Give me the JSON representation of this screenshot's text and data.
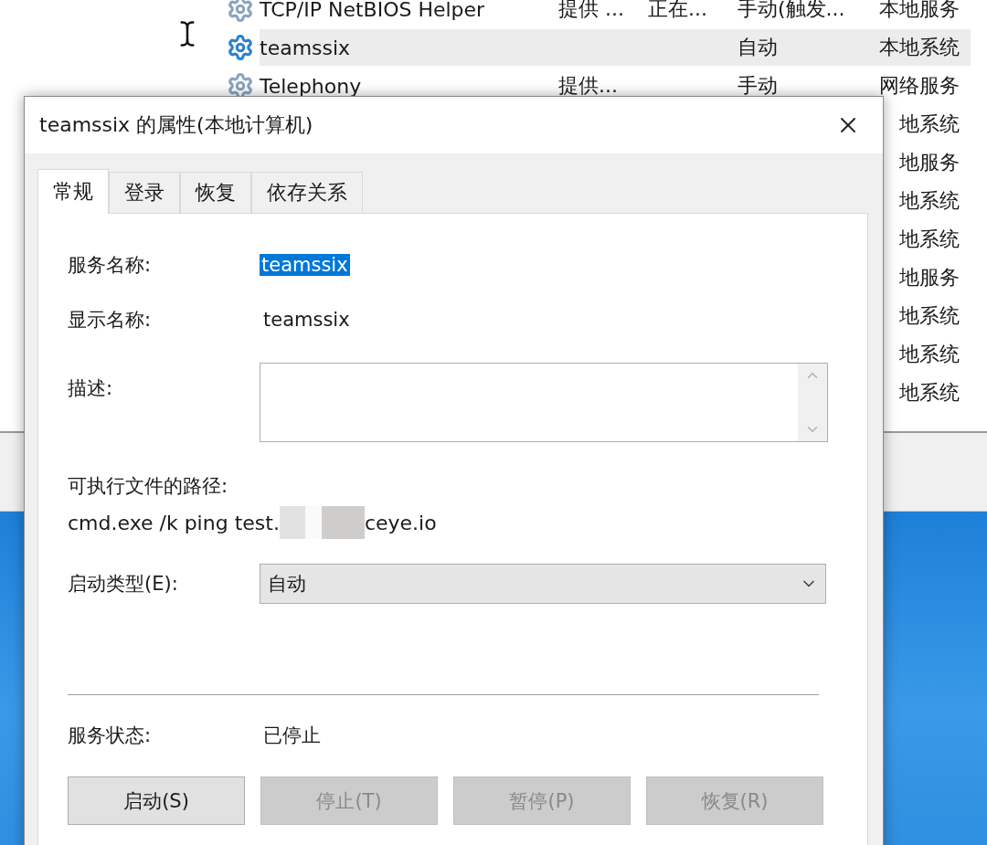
{
  "services": {
    "rows": [
      {
        "name": "TCP/IP NetBIOS Helper",
        "description": "提供 ...",
        "status": "正在...",
        "startup": "手动(触发...",
        "logon": "本地服务",
        "selected": false
      },
      {
        "name": "teamssix",
        "startup": "自动",
        "logon": "本地系统",
        "selected": true
      },
      {
        "name": "Telephony",
        "description": "提供...",
        "startup": "手动",
        "logon": "网络服务",
        "selected": false
      },
      {
        "logon": "地系统",
        "selected": false
      },
      {
        "logon": "地服务",
        "selected": false
      },
      {
        "logon": "地系统",
        "selected": false
      },
      {
        "logon": "地系统",
        "selected": false
      },
      {
        "logon": "地服务",
        "selected": false
      },
      {
        "logon": "地系统",
        "selected": false
      },
      {
        "logon": "地系统",
        "selected": false
      },
      {
        "logon": "地系统",
        "selected": false
      }
    ]
  },
  "dialog": {
    "title": "teamssix 的属性(本地计算机)",
    "tabs": [
      {
        "label": "常规",
        "selected": true
      },
      {
        "label": "登录",
        "selected": false
      },
      {
        "label": "恢复",
        "selected": false
      },
      {
        "label": "依存关系",
        "selected": false
      }
    ],
    "service_name": {
      "label": "服务名称:",
      "value": "teamssix",
      "highlighted": true
    },
    "display_name": {
      "label": "显示名称:",
      "value": "teamssix"
    },
    "description": {
      "label": "描述:"
    },
    "executable_path": {
      "label": "可执行文件的路径:",
      "value_start": "cmd.exe /k ping test.",
      "value_end": "ceye.io"
    },
    "startup_type": {
      "label": "启动类型(E):",
      "value": "自动"
    },
    "service_status": {
      "label": "服务状态:",
      "value": "已停止"
    },
    "buttons": [
      {
        "label": "启动(S)",
        "disabled": false
      },
      {
        "label": "停止(T)",
        "disabled": true
      },
      {
        "label": "暂停(P)",
        "disabled": true
      },
      {
        "label": "恢复(R)",
        "disabled": true
      }
    ]
  }
}
